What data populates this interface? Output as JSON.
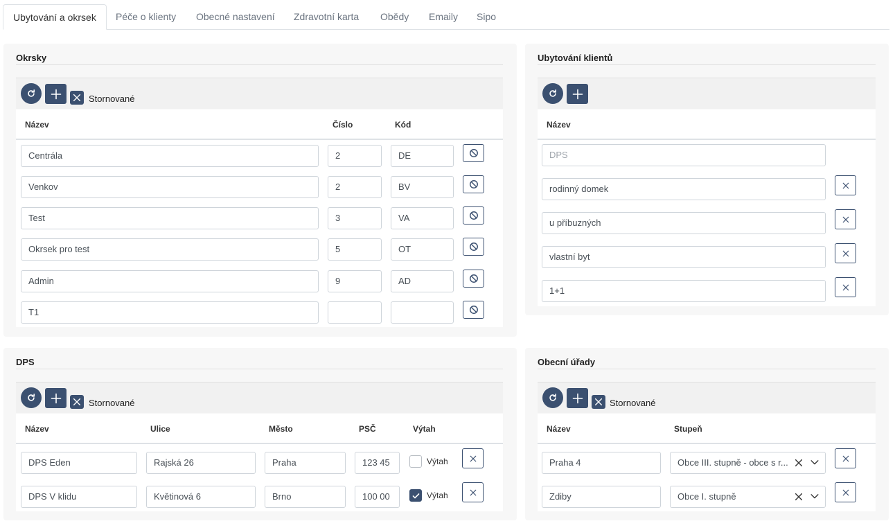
{
  "tabs": [
    "Ubytování a okrsek",
    "Péče o klienty",
    "Obecné nastavení",
    "Zdravotní karta",
    "Obědy",
    "Emaily",
    "Sipo"
  ],
  "okrsky": {
    "title": "Okrsky",
    "stornovane_label": "Stornované",
    "headers": {
      "nazev": "Název",
      "cislo": "Číslo",
      "kod": "Kód"
    },
    "rows": [
      {
        "nazev": "Centrála",
        "cislo": "2",
        "kod": "DE"
      },
      {
        "nazev": "Venkov",
        "cislo": "2",
        "kod": "BV"
      },
      {
        "nazev": "Test",
        "cislo": "3",
        "kod": "VA"
      },
      {
        "nazev": "Okrsek pro test",
        "cislo": "5",
        "kod": "OT"
      },
      {
        "nazev": "Admin",
        "cislo": "9",
        "kod": "AD"
      },
      {
        "nazev": "T1",
        "cislo": "",
        "kod": ""
      }
    ]
  },
  "ubytovani": {
    "title": "Ubytování klientů",
    "headers": {
      "nazev": "Název"
    },
    "new_placeholder": "DPS",
    "rows": [
      "rodinný domek",
      "u příbuzných",
      "vlastní byt",
      "1+1"
    ]
  },
  "dps": {
    "title": "DPS",
    "stornovane_label": "Stornované",
    "headers": {
      "nazev": "Název",
      "ulice": "Ulice",
      "mesto": "Město",
      "psc": "PSČ",
      "vytah": "Výtah"
    },
    "rows": [
      {
        "nazev": "DPS Eden",
        "ulice": "Rajská 26",
        "mesto": "Praha",
        "psc": "123 45",
        "vytah": false,
        "vytah_label": "Výtah"
      },
      {
        "nazev": "DPS V klidu",
        "ulice": "Květinová 6",
        "mesto": "Brno",
        "psc": "100 00",
        "vytah": true,
        "vytah_label": "Výtah"
      }
    ]
  },
  "obecni": {
    "title": "Obecní úřady",
    "stornovane_label": "Stornované",
    "headers": {
      "nazev": "Název",
      "stupen": "Stupeň"
    },
    "rows": [
      {
        "nazev": "Praha 4",
        "stupen": "Obce III. stupně - obce s r..."
      },
      {
        "nazev": "Zdiby",
        "stupen": "Obce I. stupně"
      }
    ]
  },
  "icons": {
    "refresh": "refresh-icon",
    "add": "plus-icon",
    "close": "close-icon",
    "cancel": "ban-icon",
    "chevron": "chevron-down-icon",
    "check": "check-icon"
  },
  "colors": {
    "primary": "#3b5070",
    "card_bg": "#f7f7f7",
    "border": "#ced4da"
  }
}
